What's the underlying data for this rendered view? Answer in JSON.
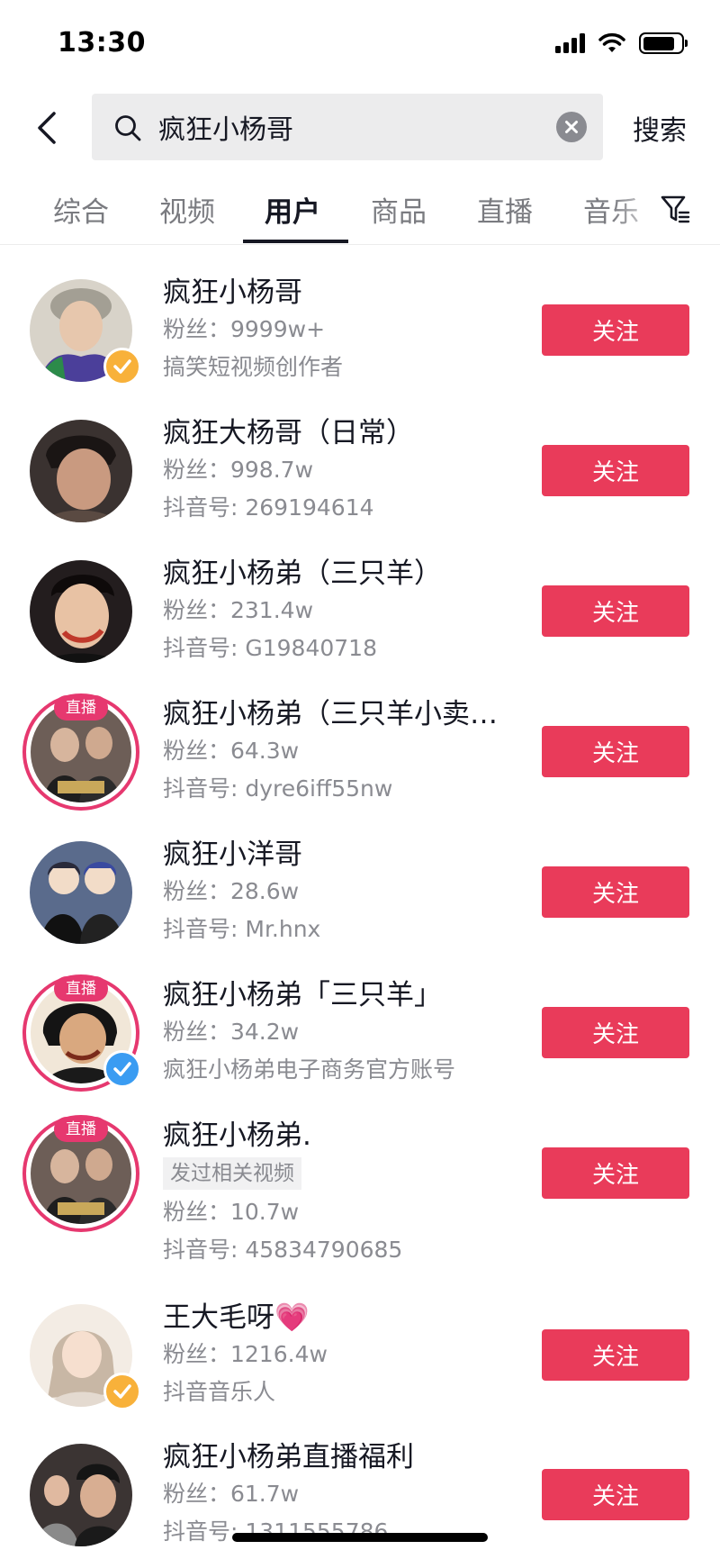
{
  "status": {
    "time": "13:30"
  },
  "search": {
    "query": "疯狂小杨哥",
    "submit_label": "搜索"
  },
  "tabs": [
    {
      "label": "综合"
    },
    {
      "label": "视频"
    },
    {
      "label": "用户",
      "active": true
    },
    {
      "label": "商品"
    },
    {
      "label": "直播"
    },
    {
      "label": "音乐"
    }
  ],
  "users": [
    {
      "name": "疯狂小杨哥",
      "fans": "粉丝：9999w+",
      "detail": "搞笑短视频创作者",
      "verified": "gold",
      "live": false,
      "follow_label": "关注"
    },
    {
      "name": "疯狂大杨哥（日常）",
      "fans": "粉丝：998.7w",
      "detail": "抖音号: 269194614",
      "live": false,
      "follow_label": "关注"
    },
    {
      "name": "疯狂小杨弟（三只羊）",
      "fans": "粉丝：231.4w",
      "detail": "抖音号: G19840718",
      "live": false,
      "follow_label": "关注"
    },
    {
      "name": "疯狂小杨弟（三只羊小卖…",
      "fans": "粉丝：64.3w",
      "detail": "抖音号: dyre6iff55nw",
      "live": true,
      "live_label": "直播",
      "follow_label": "关注"
    },
    {
      "name": "疯狂小洋哥",
      "fans": "粉丝：28.6w",
      "detail": "抖音号: Mr.hnx",
      "live": false,
      "follow_label": "关注"
    },
    {
      "name": "疯狂小杨弟「三只羊」",
      "fans": "粉丝：34.2w",
      "detail": "疯狂小杨弟电子商务官方账号",
      "verified": "blue",
      "live": true,
      "live_label": "直播",
      "follow_label": "关注"
    },
    {
      "name": "疯狂小杨弟.",
      "tag": "发过相关视频",
      "fans": "粉丝：10.7w",
      "detail": "抖音号: 45834790685",
      "live": true,
      "live_label": "直播",
      "follow_label": "关注"
    },
    {
      "name": "王大毛呀💗",
      "fans": "粉丝：1216.4w",
      "detail": "抖音音乐人",
      "verified": "gold",
      "live": false,
      "follow_label": "关注"
    },
    {
      "name": "疯狂小杨弟直播福利",
      "fans": "粉丝：61.7w",
      "detail": "抖音号: 1311555786",
      "live": false,
      "follow_label": "关注"
    }
  ],
  "colors": {
    "accent": "#e93b5a",
    "live_ring": "#e6386f",
    "verified_gold": "#f8b13a",
    "verified_blue": "#3a9cf2"
  }
}
